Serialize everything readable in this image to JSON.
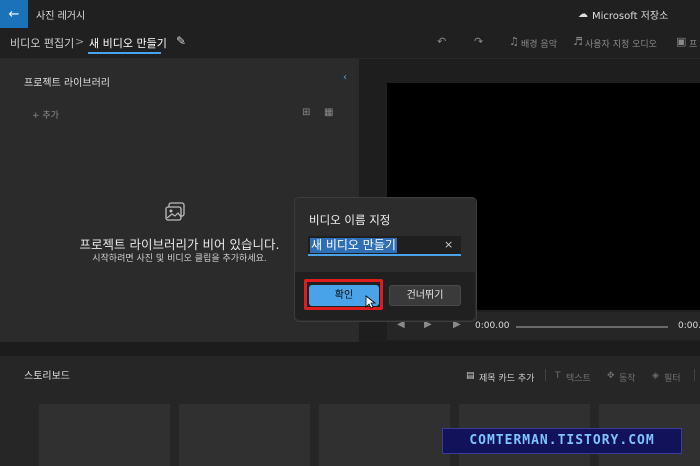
{
  "titlebar": {
    "back_icon": "arrow-left-icon",
    "title": "사진 레거시",
    "store_label": "Microsoft 저장소"
  },
  "toolbar": {
    "crumb_edit": "비디오 편집기",
    "crumb_sep": ">",
    "crumb_new": "새 비디오 만들기",
    "bg_music": "배경 음악",
    "custom_audio": "사용자 지정 오디오",
    "more": "프"
  },
  "library": {
    "title": "프로젝트 라이브러리",
    "add": "+ 추가",
    "empty_title": "프로젝트 라이브러리가 비어 있습니다.",
    "empty_sub": "시작하려면 사진 및 비디오 클립을 추가하세요."
  },
  "player": {
    "time_current": "0:00.00",
    "time_total": "0:00."
  },
  "storyboard": {
    "title": "스토리보드",
    "add_title_card": "제목 카드 추가",
    "text": "텍스트",
    "motion": "동작",
    "filter": "필터"
  },
  "dialog": {
    "title": "비디오 이름 지정",
    "input_value": "새 비디오 만들기",
    "clear": "×",
    "ok": "확인",
    "skip": "건너뛰기"
  },
  "watermark": "COMTERMAN.TISTORY.COM",
  "colors": {
    "accent": "#4aa3e8",
    "highlight": "#e01d1d",
    "back_button": "#1a73b8"
  }
}
